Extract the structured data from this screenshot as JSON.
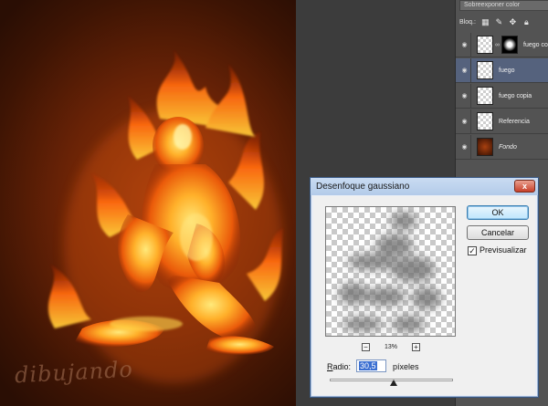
{
  "watermark": "dibujando",
  "layers_panel": {
    "blend_mode": "Sobreexponer color",
    "lock_label": "Bloq.:",
    "lock_icons": [
      "lock-transparent-icon",
      "brush-icon",
      "move-icon",
      "lock-icon"
    ],
    "layers": [
      {
        "name": "fuego co",
        "italic": false,
        "selected": false,
        "thumb": "transparent",
        "has_mask": true
      },
      {
        "name": "fuego",
        "italic": false,
        "selected": true,
        "thumb": "transparent",
        "has_mask": false
      },
      {
        "name": "fuego copia",
        "italic": false,
        "selected": false,
        "thumb": "transparent",
        "has_mask": false
      },
      {
        "name": "Referencia",
        "italic": false,
        "selected": false,
        "thumb": "transparent",
        "has_mask": false
      },
      {
        "name": "Fondo",
        "italic": true,
        "selected": false,
        "thumb": "fondo",
        "has_mask": false
      }
    ]
  },
  "dialog": {
    "title": "Desenfoque gaussiano",
    "close_symbol": "x",
    "ok_label": "OK",
    "cancel_label": "Cancelar",
    "preview_label": "Previsualizar",
    "preview_checked": true,
    "zoom_out": "−",
    "zoom_in": "+",
    "zoom_level": "13%",
    "radius_label_first": "R",
    "radius_label_rest": "adio:",
    "radius_value": "30,5",
    "radius_unit": "píxeles",
    "radius_slider_fraction": 0.52
  },
  "colors": {
    "selected_layer": "#55627d",
    "panel_bg": "#535353",
    "dialog_title_bg": "#b3cbe9",
    "fire_core": "#ffd24a",
    "fire_mid": "#ff7a12",
    "background_glow": "#9a3a0c"
  }
}
